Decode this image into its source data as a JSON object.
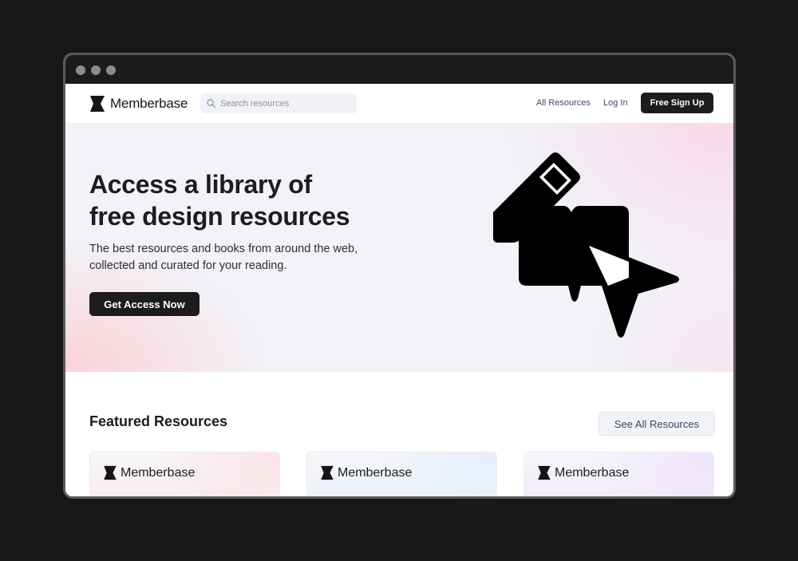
{
  "nav": {
    "brand": "Memberbase",
    "search_placeholder": "Search resources",
    "all_resources": "All Resources",
    "login": "Log In",
    "signup": "Free Sign Up"
  },
  "hero": {
    "title": "Access a library of\nfree design resources",
    "subtitle": "The best resources and books from around the web,\ncollected and curated for your reading.",
    "cta": "Get Access Now"
  },
  "featured": {
    "title": "Featured Resources",
    "see_all": "See All Resources",
    "cards": [
      {
        "brand": "Memberbase",
        "tint": "#fbe3e6"
      },
      {
        "brand": "Memberbase",
        "tint": "#e3eefb"
      },
      {
        "brand": "Memberbase",
        "tint": "#ede3fb"
      }
    ]
  },
  "colors": {
    "primary_button": "#1c1c1f",
    "page_background": "#171717"
  }
}
